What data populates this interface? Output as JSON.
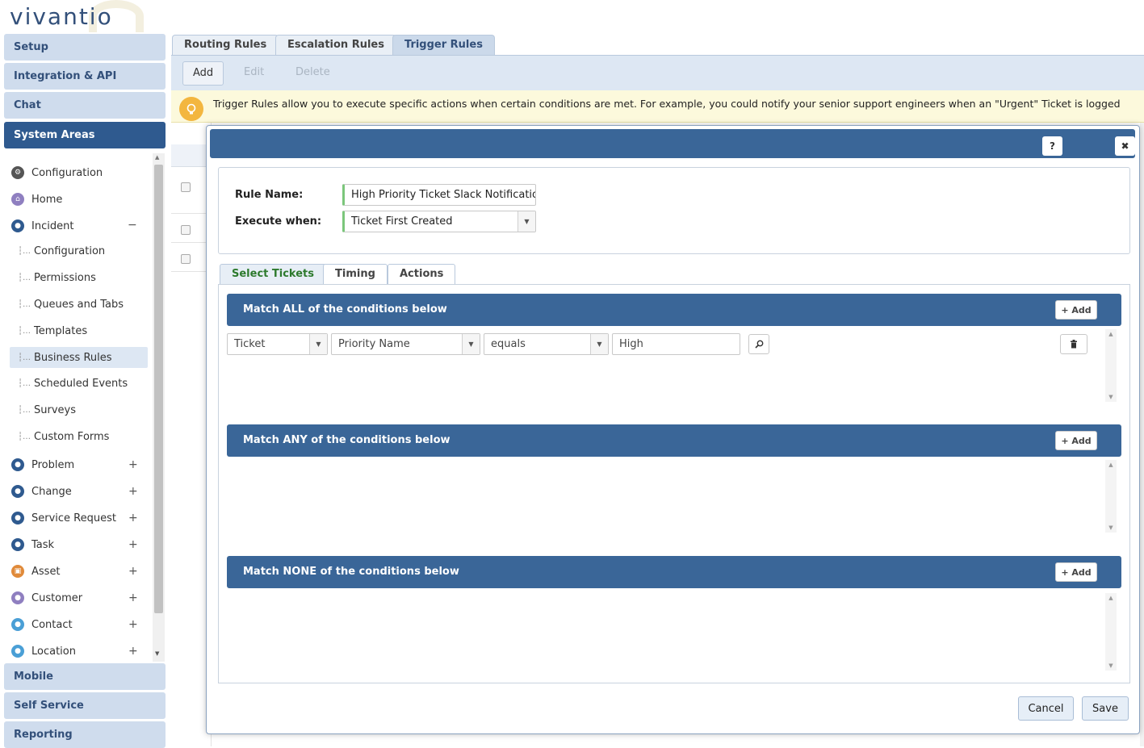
{
  "brand": {
    "logo_text": "vivantio"
  },
  "nav": {
    "setup": "Setup",
    "integration": "Integration & API",
    "chat": "Chat",
    "system_areas": "System Areas",
    "mobile": "Mobile",
    "self_service": "Self Service",
    "reporting": "Reporting"
  },
  "tree": {
    "configuration": "Configuration",
    "home": "Home",
    "incident": "Incident",
    "incident_children": [
      "Configuration",
      "Permissions",
      "Queues and Tabs",
      "Templates",
      "Business Rules",
      "Scheduled Events",
      "Surveys",
      "Custom Forms"
    ],
    "problem": "Problem",
    "change": "Change",
    "service_request": "Service Request",
    "task": "Task",
    "asset": "Asset",
    "customer": "Customer",
    "contact": "Contact",
    "location": "Location",
    "collapse_glyph": "−",
    "expand_glyph": "+"
  },
  "top_tabs": {
    "routing": "Routing Rules",
    "escalation": "Escalation Rules",
    "trigger": "Trigger Rules"
  },
  "toolbar": {
    "add": "Add",
    "edit": "Edit",
    "delete": "Delete"
  },
  "info": {
    "text": "Trigger Rules allow you to execute specific actions when certain conditions are met. For example, you could notify your senior support engineers when an \"Urgent\" Ticket is logged"
  },
  "modal": {
    "help": "?",
    "close": "✖",
    "rule_name_label": "Rule Name:",
    "rule_name_value": "High Priority Ticket Slack Notification",
    "execute_label": "Execute when:",
    "execute_value": "Ticket First Created",
    "tabs": {
      "select": "Select Tickets",
      "timing": "Timing",
      "actions": "Actions"
    },
    "match_all": "Match ALL of the conditions below",
    "match_any": "Match ANY of the conditions below",
    "match_none": "Match NONE of the conditions below",
    "add_label": "+ Add",
    "condition": {
      "entity": "Ticket",
      "field": "Priority Name",
      "operator": "equals",
      "value": "High"
    },
    "cancel": "Cancel",
    "save": "Save"
  },
  "colors": {
    "accent": "#3a6698",
    "nav_active": "#2f5a8f",
    "info_bg": "#fcf9dc"
  }
}
